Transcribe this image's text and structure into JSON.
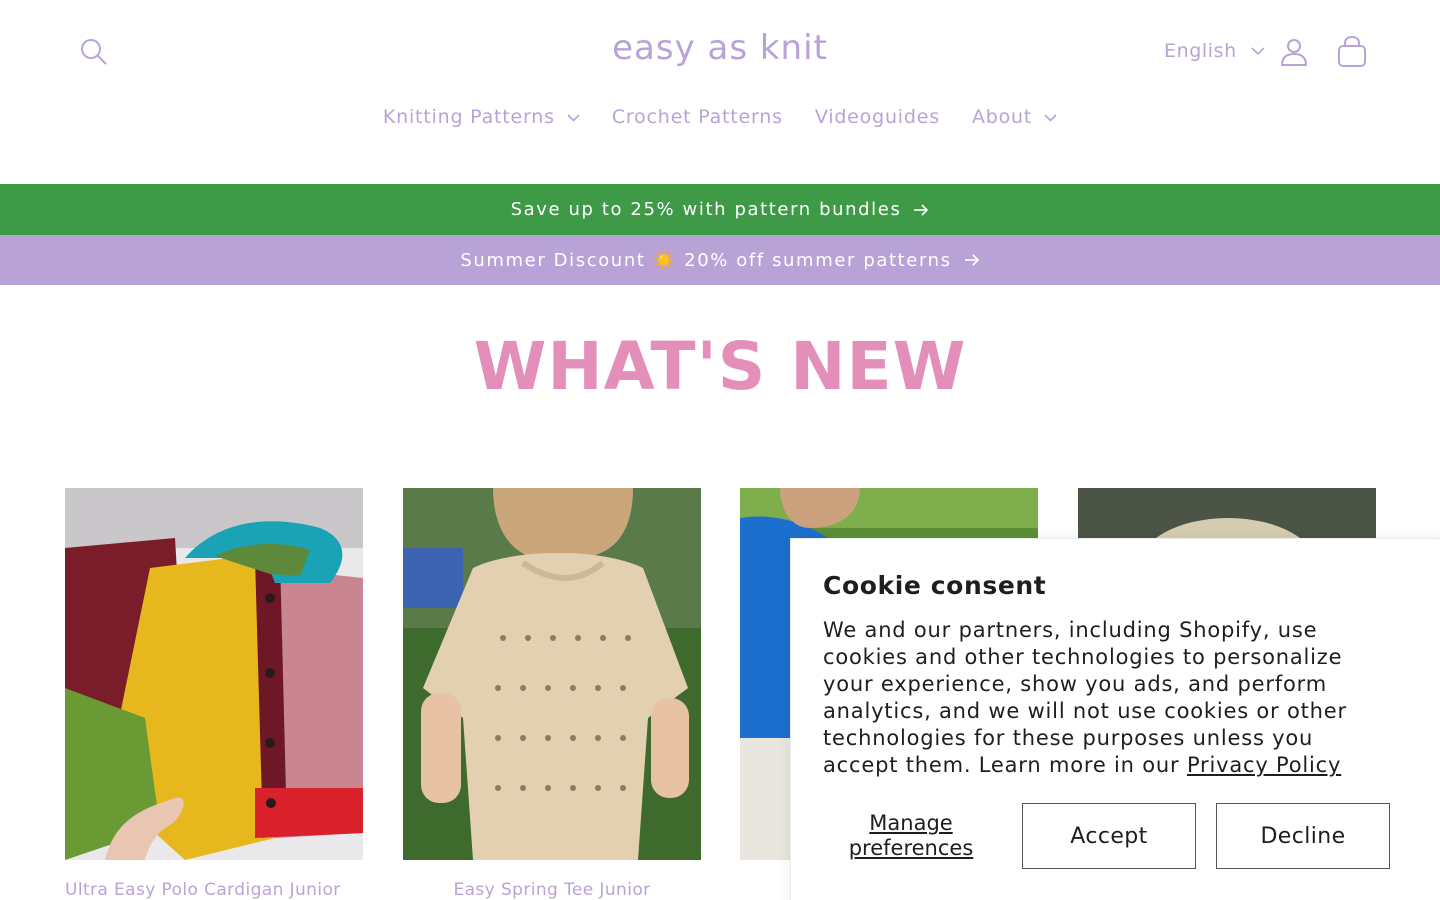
{
  "header": {
    "logo": "easy as knit",
    "language": "English",
    "icons": {
      "search": "search-icon",
      "account": "user-icon",
      "cart": "cart-icon"
    }
  },
  "nav": {
    "items": [
      {
        "label": "Knitting Patterns",
        "has_dropdown": true
      },
      {
        "label": "Crochet Patterns",
        "has_dropdown": false
      },
      {
        "label": "Videoguides",
        "has_dropdown": false
      },
      {
        "label": "About",
        "has_dropdown": true
      }
    ]
  },
  "announcements": {
    "bundles": "Save up to 25% with pattern bundles",
    "summer": "Summer Discount ☀️ 20% off summer patterns"
  },
  "section": {
    "heading": "WHAT'S NEW"
  },
  "products": [
    {
      "title": "Ultra Easy Polo Cardigan Junior"
    },
    {
      "title": "Easy Spring Tee Junior"
    }
  ],
  "cookie": {
    "title": "Cookie consent",
    "body": "We and our partners, including Shopify, use cookies and other technologies to personalize your experience, show you ads, and perform analytics, and we will not use cookies or other technologies for these purposes unless you accept them. Learn more in our",
    "link": "Privacy Policy",
    "manage": "Manage preferences",
    "accept": "Accept",
    "decline": "Decline"
  },
  "colors": {
    "brand_lilac": "#b9a3d6",
    "bundle_green": "#3e9a46",
    "heading_pink": "#e38fb9",
    "text_dark": "#1e1e1e"
  }
}
